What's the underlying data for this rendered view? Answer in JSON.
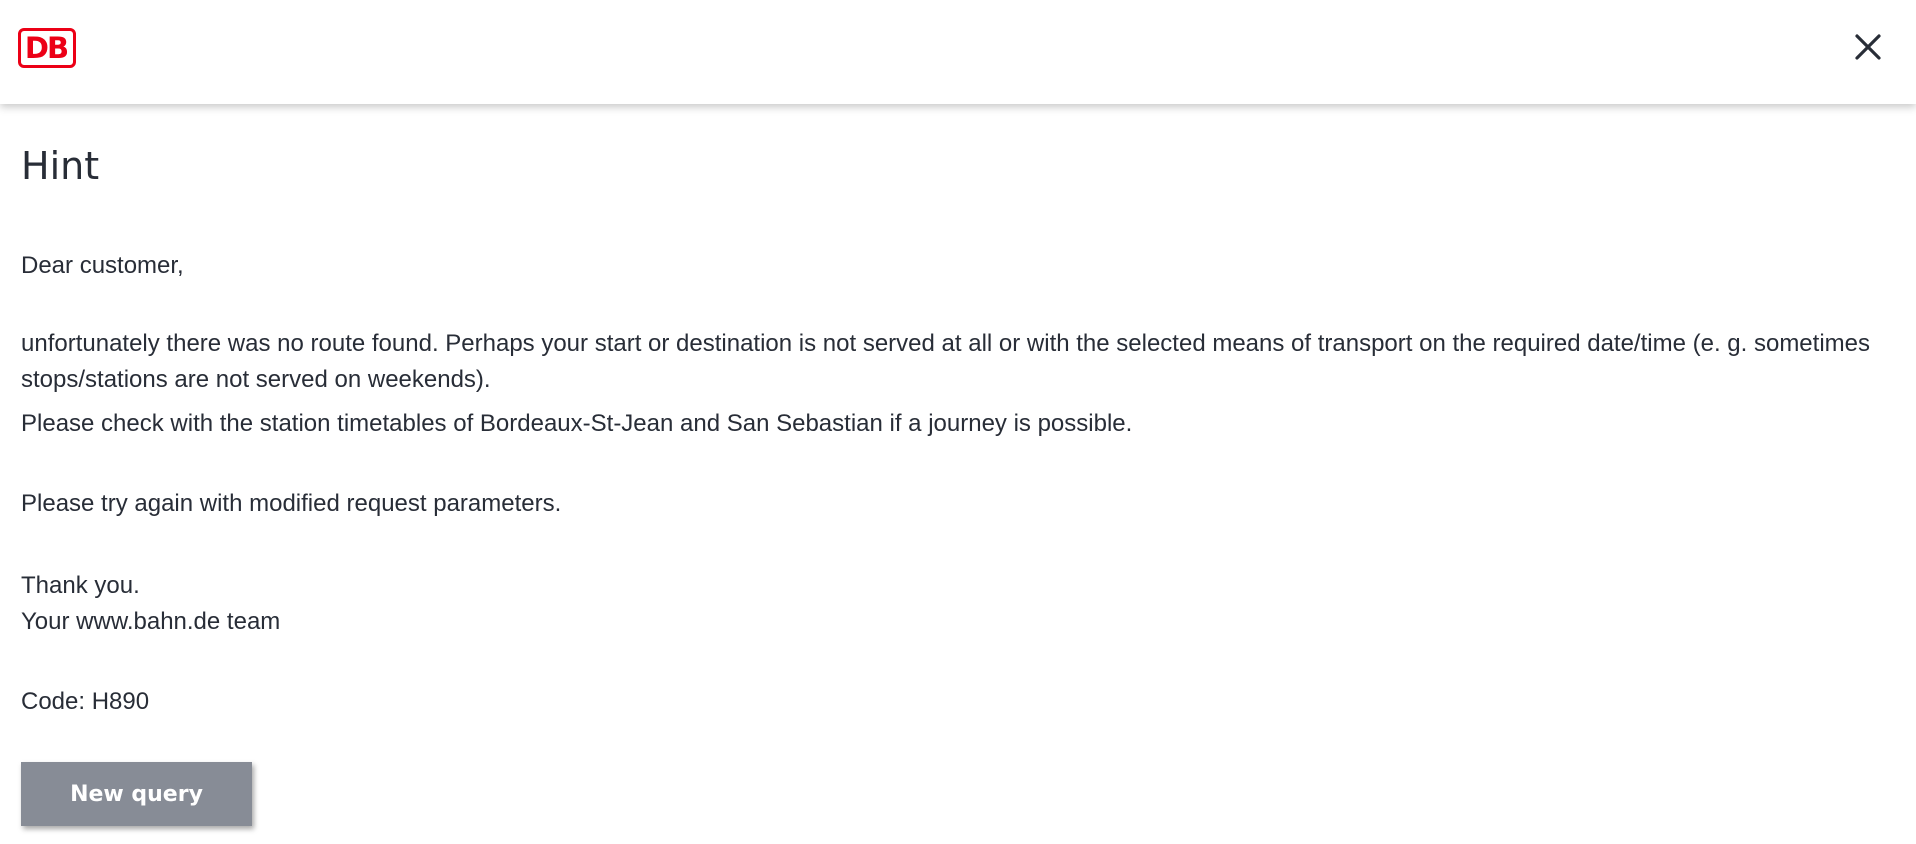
{
  "header": {
    "logo_text": "DB",
    "brand_color": "#ec0016",
    "close_icon": "close-icon"
  },
  "dialog": {
    "title": "Hint",
    "greeting": "Dear customer,",
    "message": "unfortunately there was no route found. Perhaps your start or destination is not served at all or with the selected means of transport on the required date/time (e. g. sometimes stops/stations are not served on weekends).",
    "check_stations": "Please check with the station timetables of Bordeaux-St-Jean and San Sebastian if a journey is possible.",
    "retry": "Please try again with modified request parameters.",
    "thanks": "Thank you.",
    "signature": "Your www.bahn.de team",
    "code": "Code: H890",
    "new_query_label": "New query",
    "button_color": "#878c96"
  }
}
